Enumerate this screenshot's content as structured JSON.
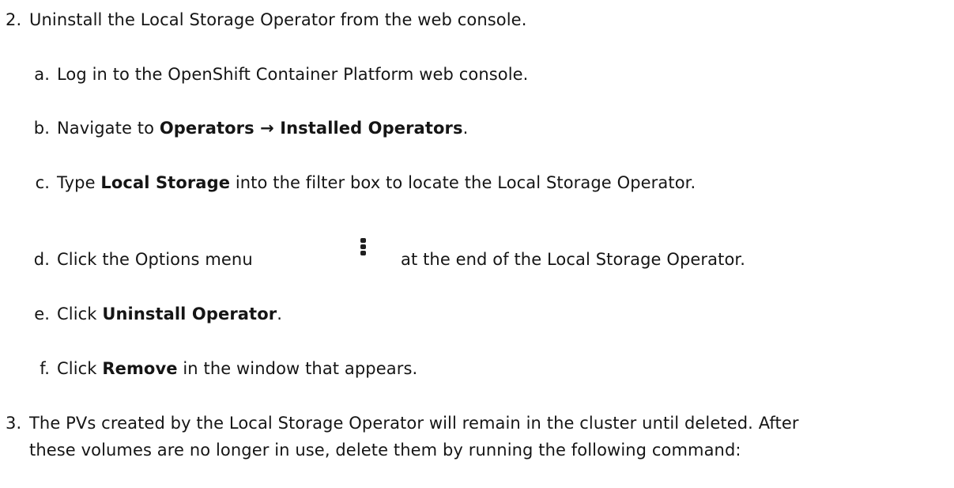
{
  "steps": [
    {
      "marker": "2.",
      "text": "Uninstall the Local Storage Operator from the web console.",
      "substeps": [
        {
          "marker": "a.",
          "text": "Log in to the OpenShift Container Platform web console."
        },
        {
          "marker": "b.",
          "pre": "Navigate to ",
          "bold": "Operators → Installed Operators",
          "post": "."
        },
        {
          "marker": "c.",
          "pre": "Type ",
          "bold": "Local Storage",
          "post": " into the filter box to locate the Local Storage Operator."
        },
        {
          "marker": "d.",
          "pre": "Click the Options menu",
          "icon": "kebab-options-icon",
          "post": "at the end of the Local Storage Operator."
        },
        {
          "marker": "e.",
          "pre": "Click ",
          "bold": "Uninstall Operator",
          "post": "."
        },
        {
          "marker": "f.",
          "pre": "Click ",
          "bold": "Remove",
          "post": " in the window that appears."
        }
      ]
    },
    {
      "marker": "3.",
      "line1": "The PVs created by the Local Storage Operator will remain in the cluster until deleted. After",
      "line2": "these volumes are no longer in use, delete them by running the following command:"
    }
  ]
}
